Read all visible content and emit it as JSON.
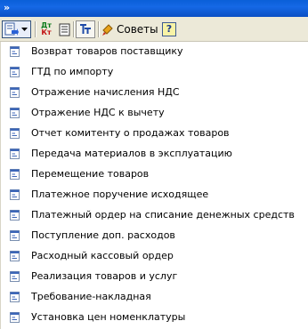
{
  "window": {
    "title_glyph": "»"
  },
  "toolbar": {
    "tips_label": "Советы",
    "help_label": "?",
    "dt_kt_top": "Дт",
    "dt_kt_bottom": "Кт"
  },
  "documents": [
    {
      "label": "Возврат товаров поставщику"
    },
    {
      "label": "ГТД по импорту"
    },
    {
      "label": "Отражение начисления НДС"
    },
    {
      "label": "Отражение НДС к вычету"
    },
    {
      "label": "Отчет комитенту о продажах товаров"
    },
    {
      "label": "Передача материалов в эксплуатацию"
    },
    {
      "label": "Перемещение товаров"
    },
    {
      "label": "Платежное поручение исходящее"
    },
    {
      "label": "Платежный ордер на списание денежных средств"
    },
    {
      "label": "Поступление доп. расходов"
    },
    {
      "label": "Расходный кассовый ордер"
    },
    {
      "label": "Реализация товаров и услуг"
    },
    {
      "label": "Требование-накладная"
    },
    {
      "label": "Установка цен номенклатуры"
    }
  ]
}
